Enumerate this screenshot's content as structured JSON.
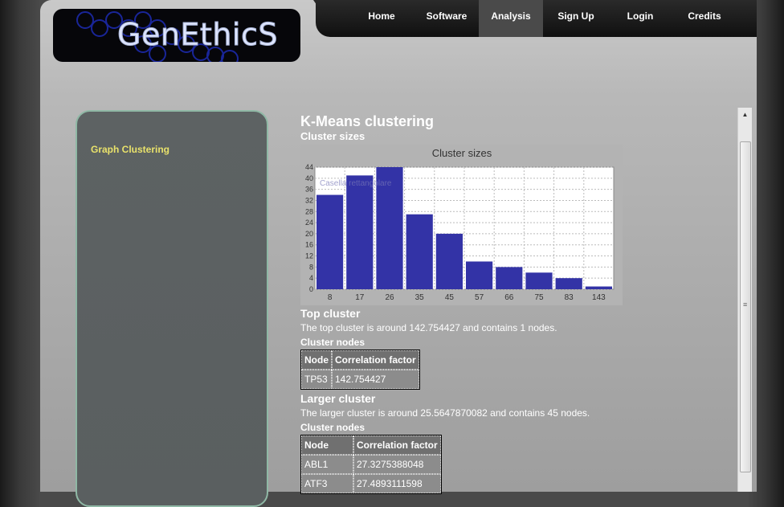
{
  "logo": {
    "text": "GenEthicS"
  },
  "nav": {
    "items": [
      "Home",
      "Software",
      "Analysis",
      "Sign Up",
      "Login",
      "Credits"
    ],
    "active": "Analysis"
  },
  "sidebar": {
    "link": "Graph Clustering"
  },
  "main": {
    "title": "K-Means clustering",
    "cluster_sizes_heading": "Cluster sizes",
    "top_cluster": {
      "heading": "Top cluster",
      "text": "The top cluster is around 142.754427 and contains 1 nodes.",
      "nodes_heading": "Cluster nodes",
      "columns": [
        "Node",
        "Correlation factor"
      ],
      "rows": [
        [
          "TP53",
          "142.754427"
        ]
      ]
    },
    "larger_cluster": {
      "heading": "Larger cluster",
      "text": "The larger cluster is around 25.5647870082 and contains 45 nodes.",
      "nodes_heading": "Cluster nodes",
      "columns": [
        "Node",
        "Correlation factor"
      ],
      "rows": [
        [
          "ABL1",
          "27.3275388048"
        ],
        [
          "ATF3",
          "27.4893111598"
        ]
      ]
    }
  },
  "chart_data": {
    "type": "bar",
    "title": "Cluster sizes",
    "categories": [
      "8",
      "17",
      "26",
      "35",
      "45",
      "57",
      "66",
      "75",
      "83",
      "143"
    ],
    "values": [
      34,
      41,
      45,
      27,
      20,
      10,
      8,
      6,
      4,
      1
    ],
    "ylim": [
      0,
      44
    ],
    "yticks": [
      0,
      4,
      8,
      12,
      16,
      20,
      24,
      28,
      32,
      36,
      40,
      44
    ],
    "grid": true,
    "bar_color": "#3333a6",
    "overlay_text": "Casella rettangolare"
  },
  "colors": {
    "sidebar_link": "#e9e26b",
    "nav_active": "#4a4a4a",
    "sidebar_border": "#8fb8a5"
  },
  "scrollbar": {
    "up_icon": "scroll-up-arrow",
    "grip_icon": "scroll-grip"
  }
}
